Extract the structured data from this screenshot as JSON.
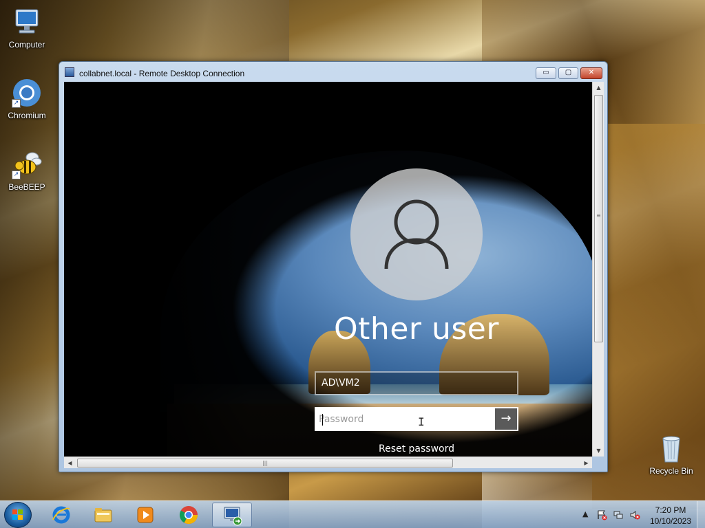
{
  "desktop": {
    "icons": [
      {
        "label": "Computer"
      },
      {
        "label": "Chromium"
      },
      {
        "label": "BeeBEEP"
      },
      {
        "label": "Recycle Bin"
      }
    ]
  },
  "rdp_window": {
    "title": "collabnet.local - Remote Desktop Connection",
    "buttons": {
      "minimize": "▭",
      "maximize": "▢",
      "close": "✕"
    },
    "lock_screen": {
      "user_name": "Other user",
      "username_value": "AD\\VM2",
      "password_placeholder": "Password",
      "submit_glyph": "→",
      "reset_link": "Reset password"
    },
    "scrollbar_glyphs": {
      "up": "▲",
      "down": "▼",
      "left": "◀",
      "right": "▶",
      "grip_v": "≡",
      "grip_h": "|||"
    }
  },
  "taskbar": {
    "items": [
      {
        "icon": "internet-explorer-icon"
      },
      {
        "icon": "file-explorer-icon"
      },
      {
        "icon": "media-player-icon"
      },
      {
        "icon": "chrome-icon"
      },
      {
        "icon": "remote-desktop-icon"
      }
    ],
    "tray": {
      "chevron": "▲"
    },
    "clock": {
      "time": "7:20 PM",
      "date": "10/10/2023"
    }
  },
  "colors": {
    "accent": "#1a5c9e",
    "close_red": "#c3452c"
  }
}
